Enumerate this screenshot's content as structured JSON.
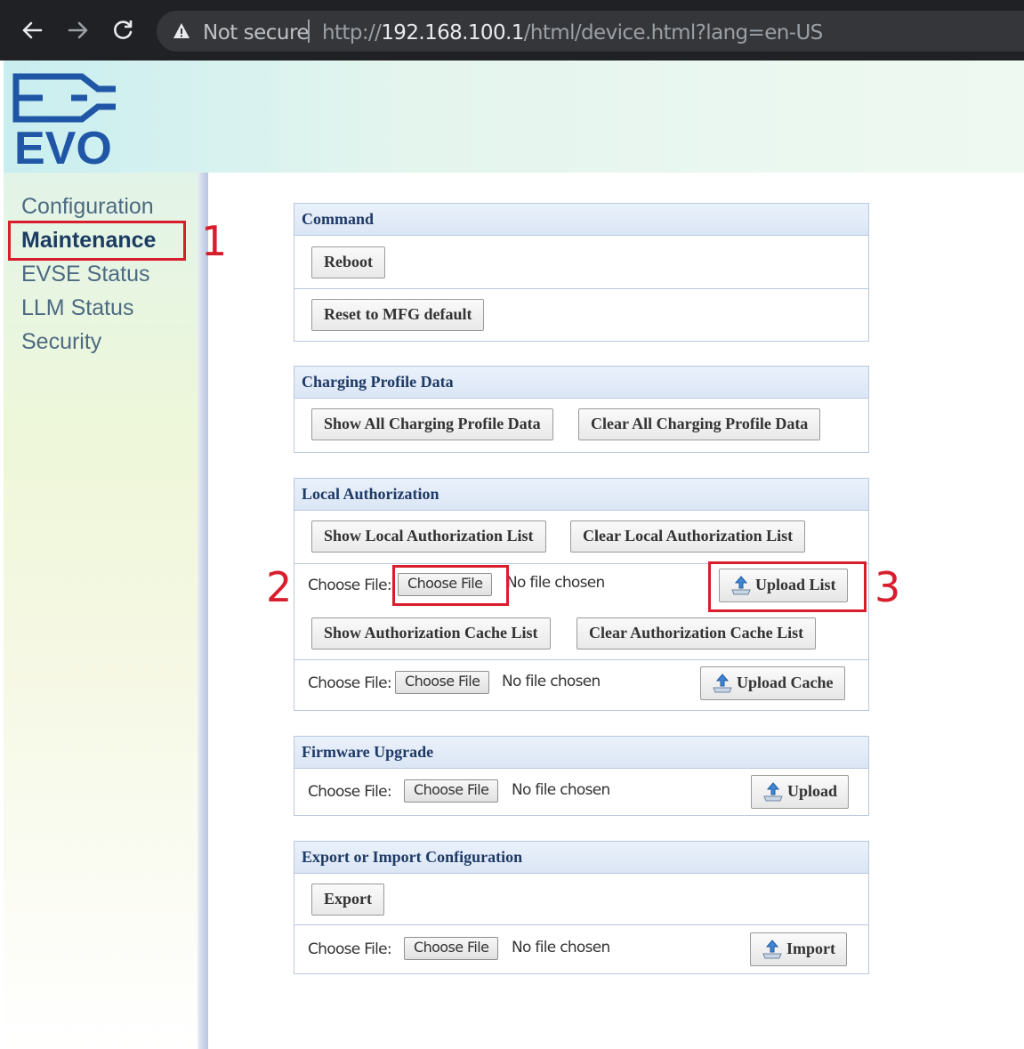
{
  "browser": {
    "not_secure": "Not secure",
    "url_prefix": "http://",
    "url_host": "192.168.100.1",
    "url_path": "/html/device.html?lang=en-US"
  },
  "logo": {
    "text": "EVO"
  },
  "sidebar": {
    "items": [
      {
        "label": "Configuration"
      },
      {
        "label": "Maintenance",
        "active": true
      },
      {
        "label": "EVSE Status"
      },
      {
        "label": "LLM Status"
      },
      {
        "label": "Security"
      }
    ]
  },
  "annotations": {
    "one": "1",
    "two": "2",
    "three": "3"
  },
  "panels": {
    "command": {
      "title": "Command",
      "reboot": "Reboot",
      "reset": "Reset to MFG default"
    },
    "charging": {
      "title": "Charging Profile Data",
      "show_all": "Show All Charging Profile Data",
      "clear_all": "Clear All Charging Profile Data"
    },
    "local_auth": {
      "title": "Local Authorization",
      "show_list": "Show Local Authorization List",
      "clear_list": "Clear Local Authorization List",
      "choose_label": "Choose File:",
      "choose_btn": "Choose File",
      "no_file": "No file chosen",
      "upload_list": "Upload List",
      "show_cache": "Show Authorization Cache List",
      "clear_cache": "Clear Authorization Cache List",
      "upload_cache": "Upload Cache"
    },
    "firmware": {
      "title": "Firmware Upgrade",
      "choose_label": "Choose File:",
      "choose_btn": "Choose File",
      "no_file": "No file chosen",
      "upload": "Upload"
    },
    "export_import": {
      "title": "Export or Import Configuration",
      "export": "Export",
      "choose_label": "Choose File:",
      "choose_btn": "Choose File",
      "no_file": "No file chosen",
      "import": "Import"
    }
  },
  "colors": {
    "accent_red": "#d81e2c",
    "nav_text": "#4d6a82",
    "panel_header_text": "#1e3a66",
    "logo_blue": "#1f57a6"
  }
}
